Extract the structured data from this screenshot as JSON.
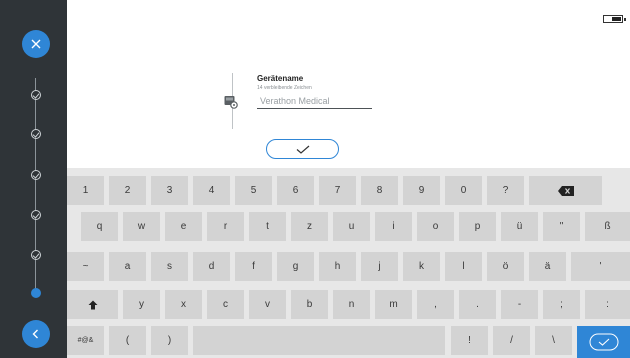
{
  "status": {
    "battery_icon": "battery-icon"
  },
  "sidebar": {
    "close_icon": "close-icon",
    "back_icon": "back-icon",
    "steps": [
      "done",
      "done",
      "done",
      "done",
      "done",
      "done",
      "current"
    ]
  },
  "form": {
    "label": "Gerätename",
    "hint": "14 verbleibende Zeichen",
    "value": "Verathon Medical",
    "device_icon": "device-settings-icon",
    "confirm_icon": "checkmark-icon"
  },
  "keyboard": {
    "row1": [
      "1",
      "2",
      "3",
      "4",
      "5",
      "6",
      "7",
      "8",
      "9",
      "0",
      "?"
    ],
    "row2": [
      "q",
      "w",
      "e",
      "r",
      "t",
      "z",
      "u",
      "i",
      "o",
      "p",
      "ü",
      "\"",
      "ß"
    ],
    "row3": [
      "~",
      "a",
      "s",
      "d",
      "f",
      "g",
      "h",
      "j",
      "k",
      "l",
      "ö",
      "ä",
      "'"
    ],
    "row4": [
      "y",
      "x",
      "c",
      "v",
      "b",
      "n",
      "m",
      ",",
      ".",
      "-",
      ";",
      ":"
    ],
    "row5": [
      "#@&",
      "(",
      ")",
      "!",
      "/",
      "\\"
    ],
    "backspace_icon": "backspace-icon",
    "shift_icon": "shift-icon",
    "enter_icon": "checkmark-icon"
  },
  "colors": {
    "accent": "#2f86d6",
    "sidebar": "#2f3438",
    "key": "#d3d3d3",
    "keyboard_bg": "#e7e7e7"
  }
}
